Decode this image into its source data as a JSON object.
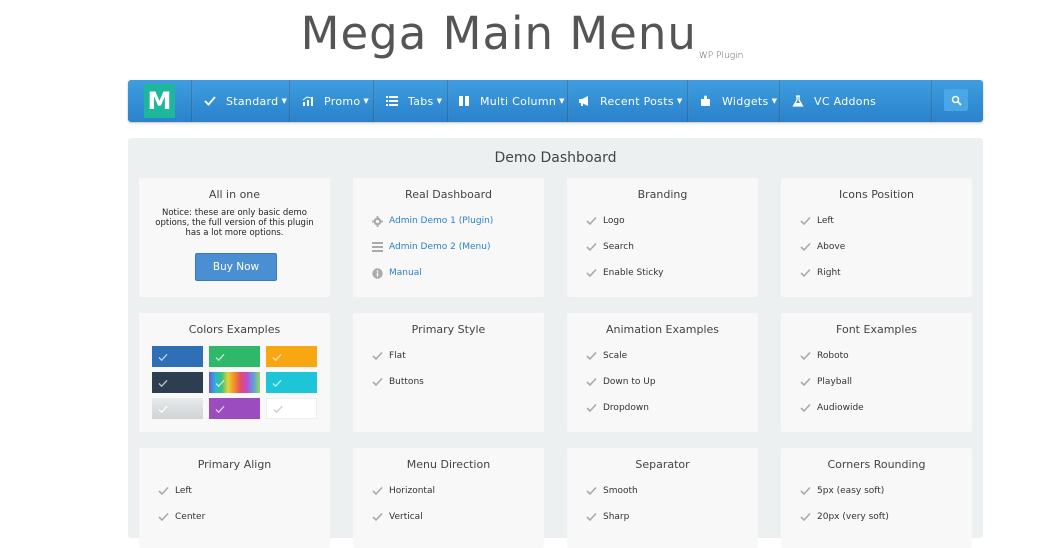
{
  "header": {
    "title": "Mega Main Menu",
    "superscript": "WP Plugin"
  },
  "navbar": {
    "logo_letter": "M",
    "items": [
      {
        "label": "Standard",
        "icon": "check-icon"
      },
      {
        "label": "Promo",
        "icon": "chart-icon"
      },
      {
        "label": "Tabs",
        "icon": "list-icon"
      },
      {
        "label": "Multi Column",
        "icon": "columns-icon"
      },
      {
        "label": "Recent Posts",
        "icon": "megaphone-icon"
      },
      {
        "label": "Widgets",
        "icon": "puzzle-icon"
      },
      {
        "label": "VC Addons",
        "icon": "flask-icon"
      }
    ],
    "search_icon": "search-icon"
  },
  "dashboard": {
    "title": "Demo Dashboard",
    "all_in_one": {
      "title": "All in one",
      "notice": "Notice: these are only basic demo options, the full version of this plugin has a lot more options.",
      "button": "Buy Now"
    },
    "real_dashboard": {
      "title": "Real Dashboard",
      "items": [
        "Admin Demo 1 (Plugin)",
        "Admin Demo 2 (Menu)",
        "Manual"
      ]
    },
    "branding": {
      "title": "Branding",
      "items": [
        "Logo",
        "Search",
        "Enable Sticky"
      ]
    },
    "icons_position": {
      "title": "Icons Position",
      "items": [
        "Left",
        "Above",
        "Right"
      ]
    },
    "colors": {
      "title": "Colors Examples",
      "swatches": [
        "#2f6fb5",
        "#2db86a",
        "#f7a712",
        "#2c3e50",
        "rainbow",
        "#1ec5d6",
        "#d7d9db",
        "#9b4dbf",
        "#ffffff"
      ]
    },
    "primary_style": {
      "title": "Primary Style",
      "items": [
        "Flat",
        "Buttons"
      ]
    },
    "animation": {
      "title": "Animation Examples",
      "items": [
        "Scale",
        "Down to Up",
        "Dropdown"
      ]
    },
    "fonts": {
      "title": "Font Examples",
      "items": [
        "Roboto",
        "Playball",
        "Audiowide"
      ]
    },
    "primary_align": {
      "title": "Primary Align",
      "items": [
        "Left",
        "Center"
      ]
    },
    "menu_direction": {
      "title": "Menu Direction",
      "items": [
        "Horizontal",
        "Vertical"
      ]
    },
    "separator": {
      "title": "Separator",
      "items": [
        "Smooth",
        "Sharp"
      ]
    },
    "corners": {
      "title": "Corners Rounding",
      "items": [
        "5px (easy soft)",
        "20px (very soft)"
      ]
    }
  }
}
